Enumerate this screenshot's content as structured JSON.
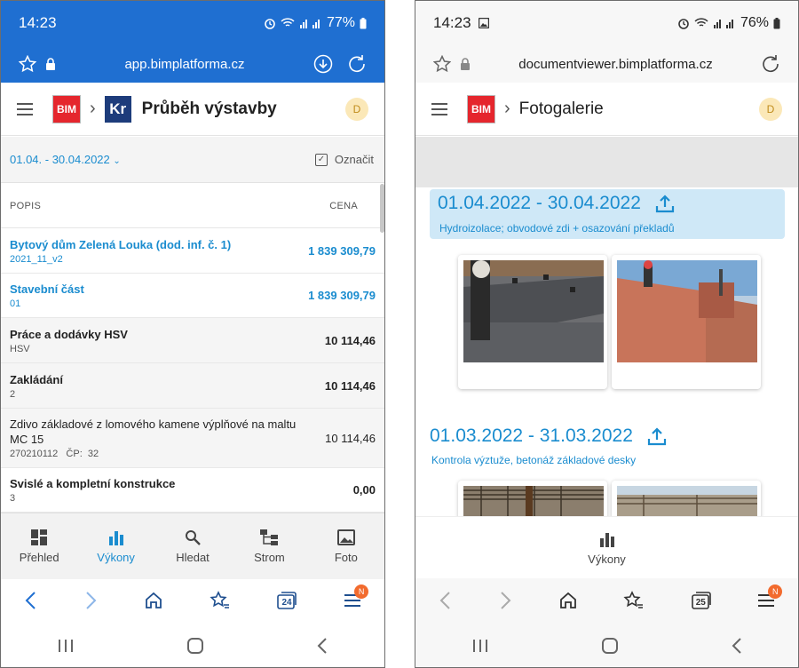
{
  "left": {
    "status_bar": {
      "time": "14:23",
      "battery": "77%"
    },
    "url": "app.bimplatforma.cz",
    "app_bar": {
      "logo_bim": "BIM",
      "logo_kr": "Kr",
      "title": "Průběh výstavby",
      "avatar": "D"
    },
    "filter": {
      "period": "01.04. - 30.04.2022",
      "mark_label": "Označit"
    },
    "columns": {
      "description": "POPIS",
      "price": "CENA"
    },
    "rows": [
      {
        "title": "Bytový dům Zelená Louka (dod. inf. č. 1)",
        "sub": "2021_11_v2",
        "value": "1 839 309,79"
      },
      {
        "title": "Stavební část",
        "sub": "01",
        "value": "1 839 309,79"
      },
      {
        "title": "Práce a dodávky HSV",
        "sub": "HSV",
        "value": "10 114,46"
      },
      {
        "title": "Zakládání",
        "sub": "2",
        "value": "10 114,46"
      },
      {
        "title": "Zdivo základové z lomového kamene výplňové na maltu MC 15",
        "sub": "270210112   ČP:  32",
        "value": "10 114,46"
      },
      {
        "title": "Svislé a kompletní konstrukce",
        "sub": "3",
        "value": "0,00"
      }
    ],
    "bottom_nav": [
      {
        "label": "Přehled",
        "icon": "dashboard-icon"
      },
      {
        "label": "Výkony",
        "icon": "bar-chart-icon"
      },
      {
        "label": "Hledat",
        "icon": "search-icon"
      },
      {
        "label": "Strom",
        "icon": "tree-icon"
      },
      {
        "label": "Foto",
        "icon": "image-icon"
      }
    ],
    "tabs_count": "24",
    "menu_badge": "N"
  },
  "right": {
    "status_bar": {
      "time": "14:23",
      "battery": "76%"
    },
    "url": "documentviewer.bimplatforma.cz",
    "app_bar": {
      "logo_bim": "BIM",
      "title": "Fotogalerie",
      "avatar": "D"
    },
    "periods": [
      {
        "range": "01.04.2022 - 30.04.2022",
        "description": "Hydroizolace; obvodové zdi + osazování překladů"
      },
      {
        "range": "01.03.2022 - 31.03.2022",
        "description": "Kontrola výztuže, betonáž základové desky"
      }
    ],
    "bottom_tab": {
      "label": "Výkony",
      "icon": "bar-chart-icon"
    },
    "tabs_count": "25",
    "menu_badge": "N"
  },
  "colors": {
    "accent": "#1a8ccf",
    "browser_blue": "#1f6fd1",
    "bim_red": "#e5262d",
    "kr_navy": "#1d3c7b",
    "badge_orange": "#f26b2e"
  }
}
